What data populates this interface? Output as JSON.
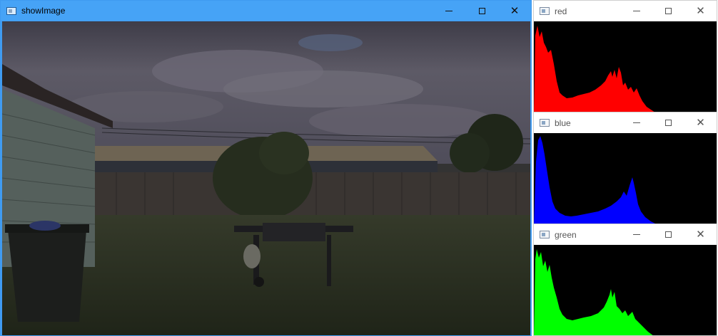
{
  "windows": {
    "main": {
      "title": "showImage"
    },
    "red": {
      "title": "red",
      "color": "#ff0000"
    },
    "blue": {
      "title": "blue",
      "color": "#0000ff"
    },
    "green": {
      "title": "green",
      "color": "#00ff00"
    }
  },
  "controls": {
    "minimize": "minimize-icon",
    "maximize": "maximize-icon",
    "close": "close-icon"
  },
  "colors": {
    "titlebar_active": "#46a3f6",
    "titlebar_inactive": "#ffffff",
    "histogram_bg": "#000000"
  }
}
